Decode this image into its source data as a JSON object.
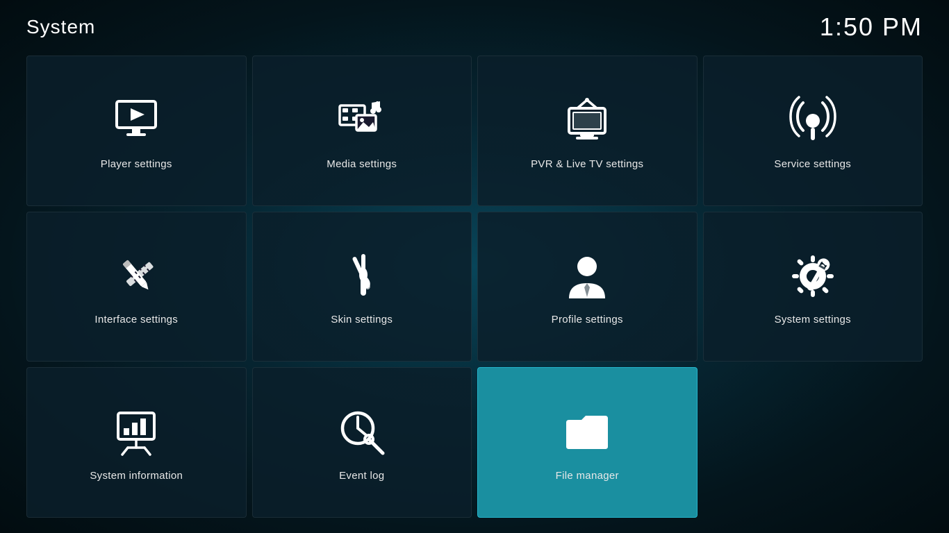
{
  "header": {
    "title": "System",
    "time": "1:50 PM"
  },
  "tiles": [
    {
      "id": "player-settings",
      "label": "Player settings",
      "icon": "player",
      "active": false
    },
    {
      "id": "media-settings",
      "label": "Media settings",
      "icon": "media",
      "active": false
    },
    {
      "id": "pvr-settings",
      "label": "PVR & Live TV settings",
      "icon": "pvr",
      "active": false
    },
    {
      "id": "service-settings",
      "label": "Service settings",
      "icon": "service",
      "active": false
    },
    {
      "id": "interface-settings",
      "label": "Interface settings",
      "icon": "interface",
      "active": false
    },
    {
      "id": "skin-settings",
      "label": "Skin settings",
      "icon": "skin",
      "active": false
    },
    {
      "id": "profile-settings",
      "label": "Profile settings",
      "icon": "profile",
      "active": false
    },
    {
      "id": "system-settings",
      "label": "System settings",
      "icon": "system",
      "active": false
    },
    {
      "id": "system-information",
      "label": "System information",
      "icon": "sysinfo",
      "active": false
    },
    {
      "id": "event-log",
      "label": "Event log",
      "icon": "eventlog",
      "active": false
    },
    {
      "id": "file-manager",
      "label": "File manager",
      "icon": "filemanager",
      "active": true
    }
  ]
}
